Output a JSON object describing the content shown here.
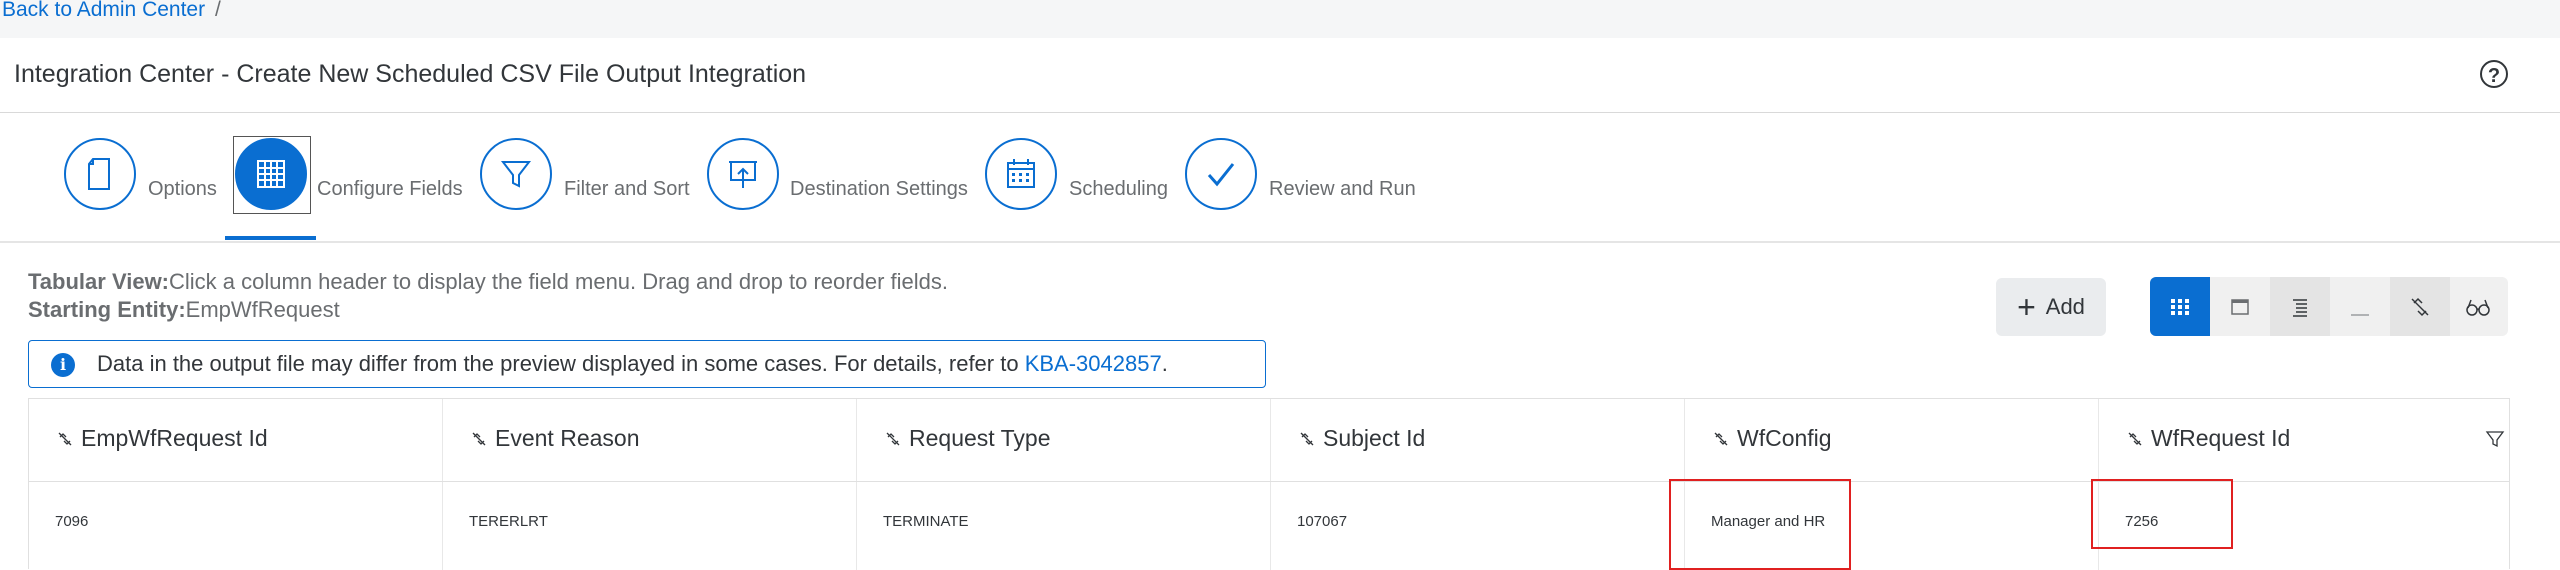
{
  "breadcrumb": {
    "back_label": "Back to Admin Center",
    "separator": "/"
  },
  "header": {
    "title": "Integration Center - Create New Scheduled CSV File Output Integration",
    "help_icon": "help-icon"
  },
  "stepper": {
    "steps": [
      {
        "label": "Options",
        "icon": "document-icon",
        "active": false
      },
      {
        "label": "Configure Fields",
        "icon": "grid-icon",
        "active": true
      },
      {
        "label": "Filter and Sort",
        "icon": "filter-icon",
        "active": false
      },
      {
        "label": "Destination Settings",
        "icon": "presentation-icon",
        "active": false
      },
      {
        "label": "Scheduling",
        "icon": "calendar-icon",
        "active": false
      },
      {
        "label": "Review and Run",
        "icon": "checkmark-icon",
        "active": false
      }
    ]
  },
  "content": {
    "tabular_label": "Tabular View:",
    "tabular_text": "Click a column header to display the field menu. Drag and drop to reorder fields.",
    "entity_label": "Starting Entity:",
    "entity_value": "EmpWfRequest"
  },
  "notice": {
    "text": "Data in the output file may differ from the preview displayed in some cases. For details, refer to ",
    "link": "KBA-3042857",
    "suffix": "."
  },
  "toolbar": {
    "add_label": "Add",
    "views": [
      "grid-view-icon",
      "window-view-icon",
      "list-view-icon",
      "underline-icon",
      "unlink-icon",
      "glasses-icon"
    ],
    "active_view": "grid-view-icon"
  },
  "table": {
    "columns": [
      "EmpWfRequest Id",
      "Event Reason",
      "Request Type",
      "Subject Id",
      "WfConfig",
      "WfRequest Id"
    ],
    "rows": [
      [
        "7096",
        "TERERLRT",
        "TERMINATE",
        "107067",
        "Manager and HR",
        "7256"
      ]
    ]
  },
  "colors": {
    "accent": "#0a6ed1",
    "highlight": "#e02020",
    "text": "#32363a",
    "muted": "#6a6d70"
  }
}
